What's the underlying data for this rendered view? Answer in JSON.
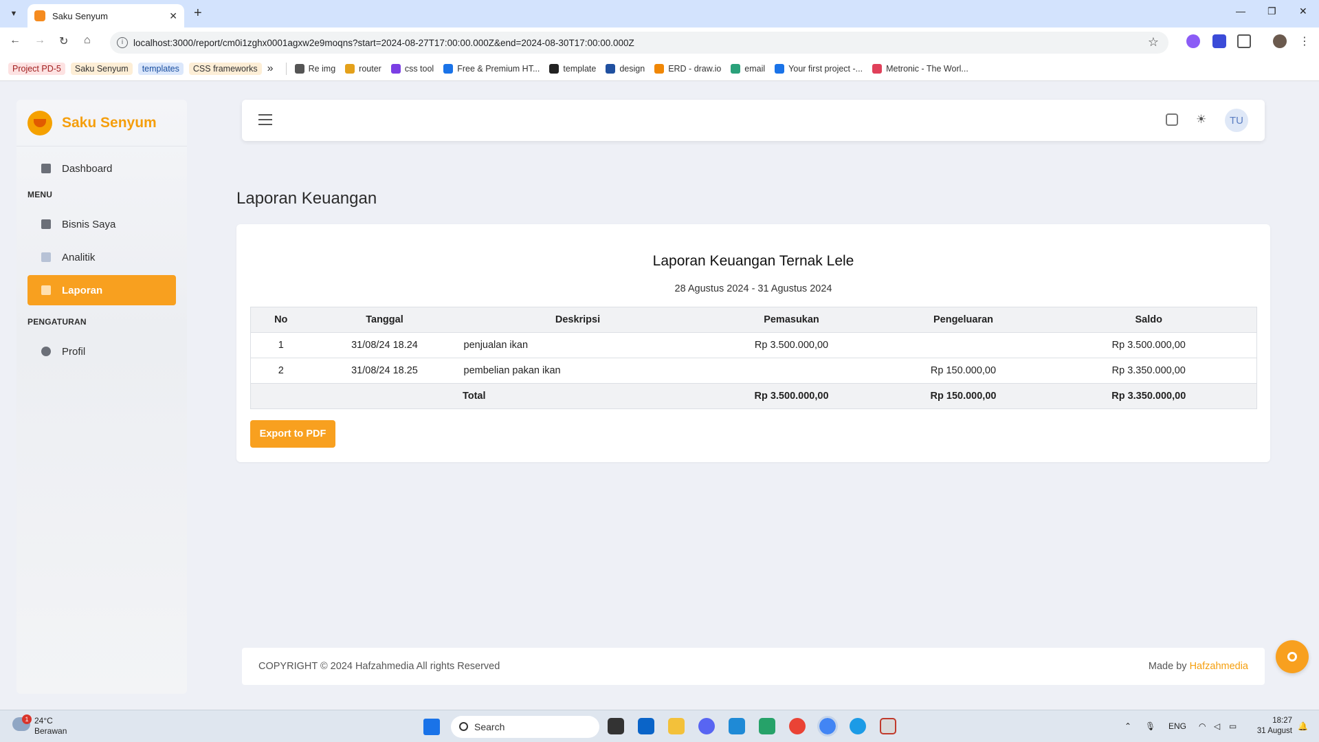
{
  "browser": {
    "tab_title": "Saku Senyum",
    "tab_close": "✕",
    "new_tab": "+",
    "url": "localhost:3000/report/cm0i1zghx0001agxw2e9moqns?start=2024-08-27T17:00:00.000Z&end=2024-08-30T17:00:00.000Z",
    "bookmarks_overflow": "»",
    "bookmarks": [
      {
        "label": "Project PD-5",
        "style": "tag",
        "bg": "#fde2e2",
        "color": "#a12020"
      },
      {
        "label": "Saku Senyum",
        "style": "tag",
        "bg": "#fdeed6",
        "color": "#333333"
      },
      {
        "label": "templates",
        "style": "tag",
        "bg": "#dbe7fb",
        "color": "#1a4fa0"
      },
      {
        "label": "CSS frameworks",
        "style": "tag",
        "bg": "#fdeed6",
        "color": "#333333"
      }
    ],
    "bookmark_links": [
      {
        "label": "Re img",
        "icon_color": "#555555"
      },
      {
        "label": "router",
        "icon_color": "#e4a11b"
      },
      {
        "label": "css tool",
        "icon_color": "#7b3fe4"
      },
      {
        "label": "Free & Premium HT...",
        "icon_color": "#1a73e8"
      },
      {
        "label": "template",
        "icon_color": "#222222"
      },
      {
        "label": "design",
        "icon_color": "#2050a0"
      },
      {
        "label": "ERD - draw.io",
        "icon_color": "#f08705"
      },
      {
        "label": "email",
        "icon_color": "#2aa17a"
      },
      {
        "label": "Your first project -...",
        "icon_color": "#1a73e8"
      },
      {
        "label": "Metronic - The Worl...",
        "icon_color": "#e0405a"
      }
    ]
  },
  "app": {
    "brand": "Saku Senyum",
    "sidebar": {
      "dashboard": "Dashboard",
      "menu_label": "MENU",
      "items": [
        {
          "label": "Bisnis Saya",
          "active": false
        },
        {
          "label": "Analitik",
          "active": false
        },
        {
          "label": "Laporan",
          "active": true
        }
      ],
      "settings_label": "PENGATURAN",
      "profile": "Profil"
    },
    "topbar": {
      "avatar_initials": "TU"
    },
    "page_title": "Laporan Keuangan",
    "report": {
      "title": "Laporan Keuangan Ternak Lele",
      "range": "28 Agustus 2024 - 31 Agustus 2024",
      "columns": [
        "No",
        "Tanggal",
        "Deskripsi",
        "Pemasukan",
        "Pengeluaran",
        "Saldo"
      ],
      "rows": [
        {
          "no": "1",
          "tanggal": "31/08/24 18.24",
          "deskripsi": "penjualan ikan",
          "pemasukan": "Rp 3.500.000,00",
          "pengeluaran": "",
          "saldo": "Rp 3.500.000,00"
        },
        {
          "no": "2",
          "tanggal": "31/08/24 18.25",
          "deskripsi": "pembelian pakan ikan",
          "pemasukan": "",
          "pengeluaran": "Rp 150.000,00",
          "saldo": "Rp 3.350.000,00"
        }
      ],
      "total": {
        "label": "Total",
        "pemasukan": "Rp 3.500.000,00",
        "pengeluaran": "Rp 150.000,00",
        "saldo": "Rp 3.350.000,00"
      },
      "export_label": "Export to PDF"
    },
    "footer": {
      "copyright": "COPYRIGHT © 2024 Hafzahmedia All rights Reserved",
      "made_by": "Made by",
      "made_by_link": "Hafzahmedia"
    },
    "accent_color": "#f8a01f"
  },
  "taskbar": {
    "weather_temp": "24°C",
    "weather_desc": "Berawan",
    "weather_badge": "1",
    "search_placeholder": "Search",
    "language": "ENG",
    "time": "18:27",
    "date": "31 August"
  }
}
